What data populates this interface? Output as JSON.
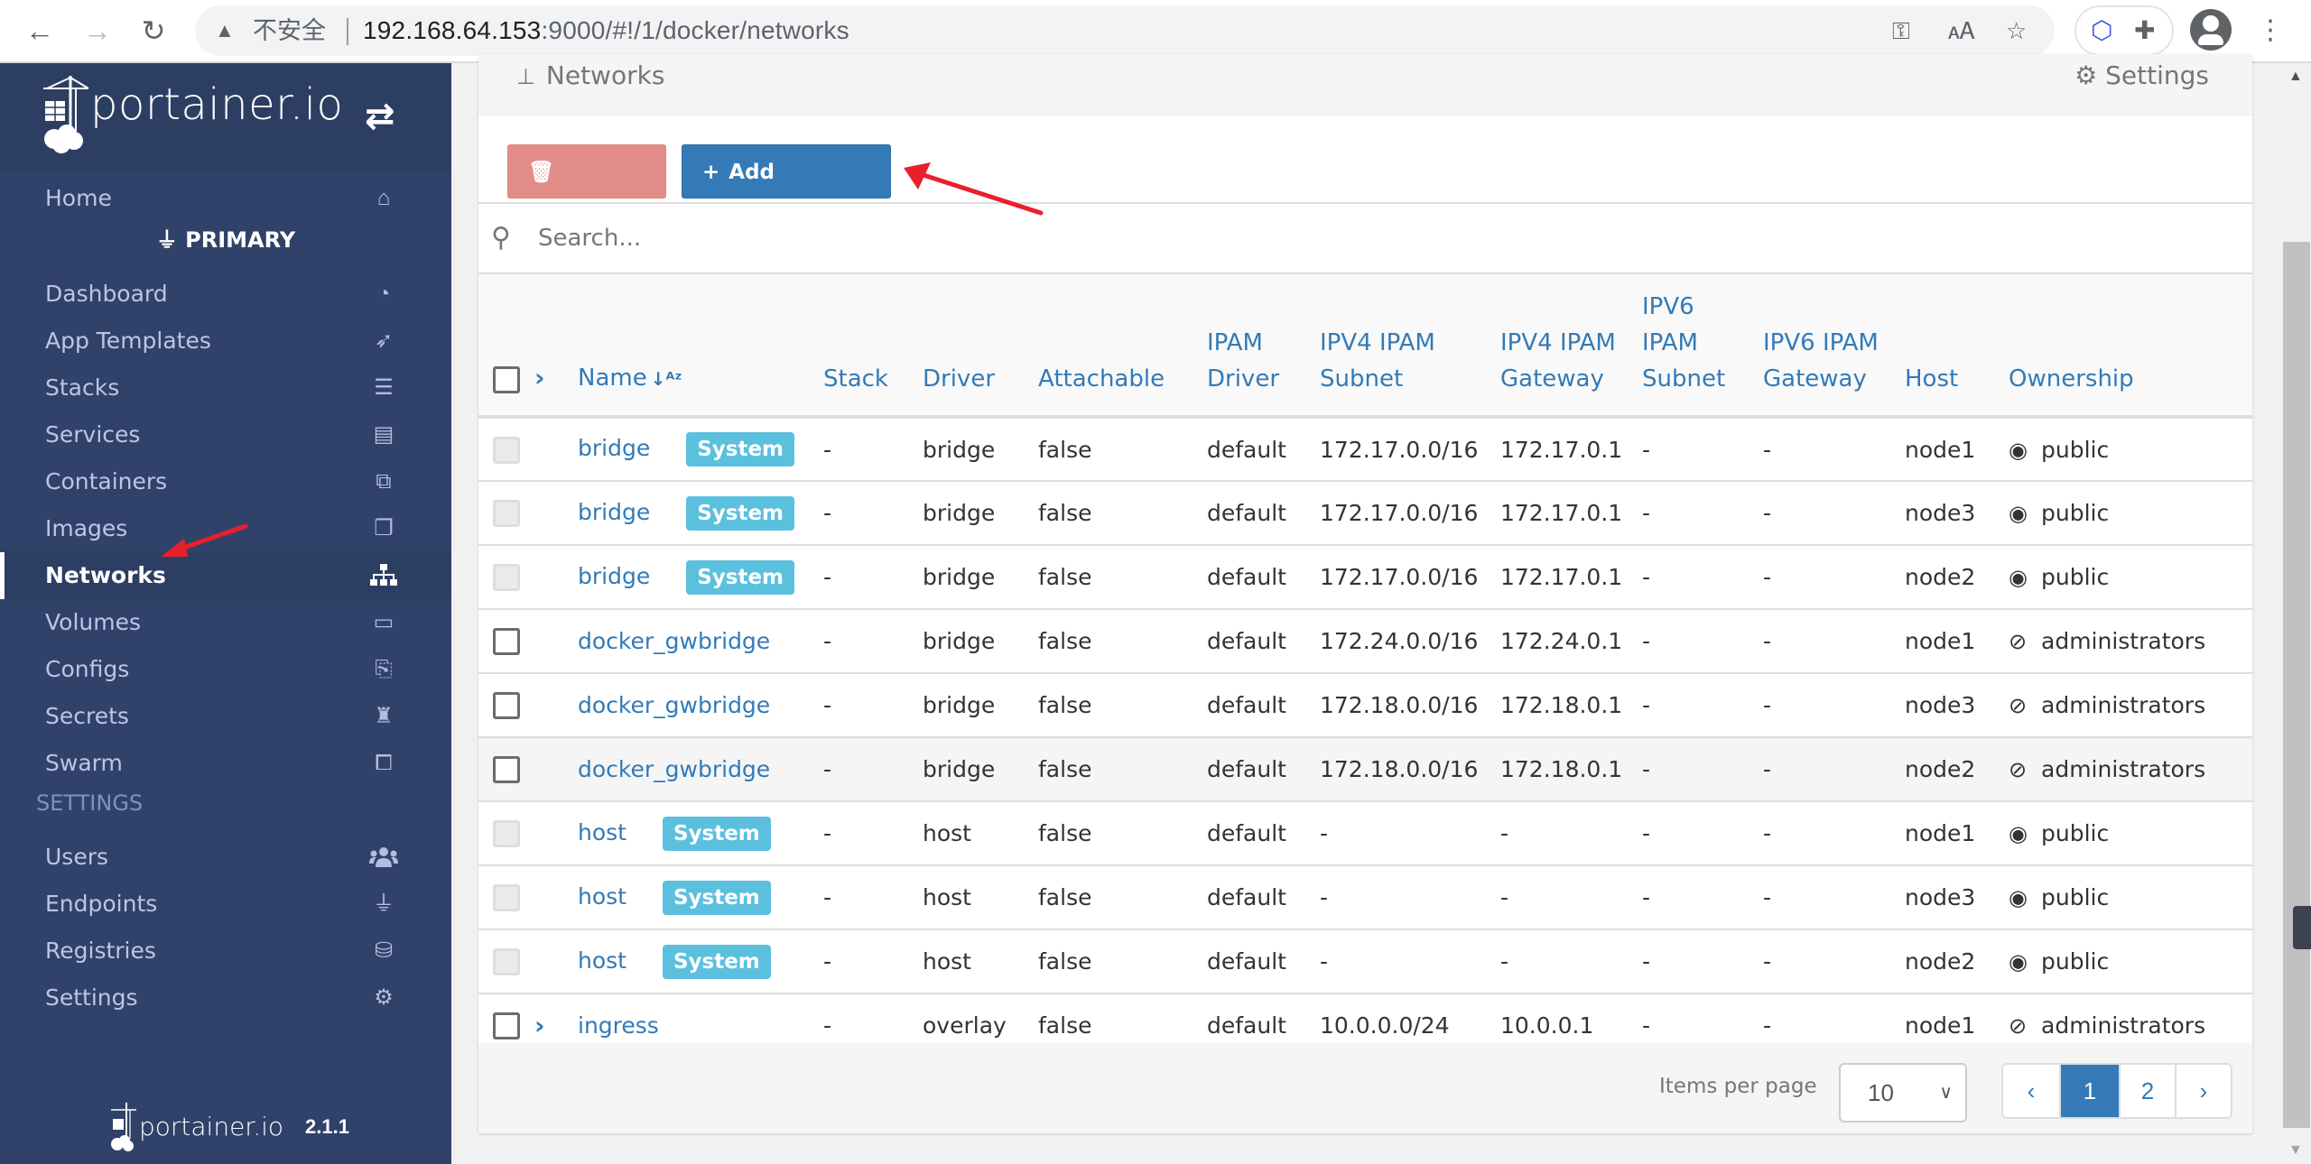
{
  "browser": {
    "security_label": "不安全",
    "url_host": "192.168.64.153",
    "url_rest": ":9000/#!/1/docker/networks",
    "icons": [
      "back-icon",
      "forward-icon",
      "reload-icon",
      "warning-icon",
      "key-icon",
      "translate-icon",
      "star-icon",
      "extension-cube-icon",
      "puzzle-icon",
      "profile-icon",
      "menu-icon"
    ]
  },
  "sidebar": {
    "brand": "portainer.io",
    "endpoint": "PRIMARY",
    "section_settings": "SETTINGS",
    "version": "2.1.1",
    "items": [
      {
        "label": "Home",
        "icon": "home-icon",
        "glyph": "⌂"
      },
      {
        "label": "Dashboard",
        "icon": "tachometer-icon",
        "glyph": "◔"
      },
      {
        "label": "App Templates",
        "icon": "rocket-icon",
        "glyph": "➶"
      },
      {
        "label": "Stacks",
        "icon": "th-list-icon",
        "glyph": "☰"
      },
      {
        "label": "Services",
        "icon": "list-alt-icon",
        "glyph": "▤"
      },
      {
        "label": "Containers",
        "icon": "cubes-icon",
        "glyph": "⧉"
      },
      {
        "label": "Images",
        "icon": "clone-icon",
        "glyph": "❐"
      },
      {
        "label": "Networks",
        "icon": "sitemap-icon",
        "glyph": "⊥",
        "active": true
      },
      {
        "label": "Volumes",
        "icon": "hdd-icon",
        "glyph": "▭"
      },
      {
        "label": "Configs",
        "icon": "file-code-icon",
        "glyph": "⎘"
      },
      {
        "label": "Secrets",
        "icon": "user-secret-icon",
        "glyph": "♜"
      },
      {
        "label": "Swarm",
        "icon": "object-group-icon",
        "glyph": "⧠"
      },
      {
        "label": "Users",
        "icon": "users-icon",
        "glyph": "👥"
      },
      {
        "label": "Endpoints",
        "icon": "plug-icon",
        "glyph": "⏚"
      },
      {
        "label": "Registries",
        "icon": "database-icon",
        "glyph": "⛁"
      },
      {
        "label": "Settings",
        "icon": "cogs-icon",
        "glyph": "⚙"
      }
    ]
  },
  "panel": {
    "title": "Networks",
    "settings_label": "Settings",
    "remove_label": "Remove",
    "add_label": "Add network",
    "search_placeholder": "Search..."
  },
  "table": {
    "headers": [
      "Name",
      "Stack",
      "Driver",
      "Attachable",
      "IPAM Driver",
      "IPV4 IPAM Subnet",
      "IPV4 IPAM Gateway",
      "IPV6 IPAM Subnet",
      "IPV6 IPAM Gateway",
      "Host",
      "Ownership"
    ],
    "rows": [
      {
        "name": "bridge",
        "system": true,
        "stack": "-",
        "driver": "bridge",
        "attachable": "false",
        "ipam_driver": "default",
        "ipv4_subnet": "172.17.0.0/16",
        "ipv4_gateway": "172.17.0.1",
        "ipv6_subnet": "-",
        "ipv6_gateway": "-",
        "host": "node1",
        "ownership": "public"
      },
      {
        "name": "bridge",
        "system": true,
        "stack": "-",
        "driver": "bridge",
        "attachable": "false",
        "ipam_driver": "default",
        "ipv4_subnet": "172.17.0.0/16",
        "ipv4_gateway": "172.17.0.1",
        "ipv6_subnet": "-",
        "ipv6_gateway": "-",
        "host": "node3",
        "ownership": "public"
      },
      {
        "name": "bridge",
        "system": true,
        "stack": "-",
        "driver": "bridge",
        "attachable": "false",
        "ipam_driver": "default",
        "ipv4_subnet": "172.17.0.0/16",
        "ipv4_gateway": "172.17.0.1",
        "ipv6_subnet": "-",
        "ipv6_gateway": "-",
        "host": "node2",
        "ownership": "public"
      },
      {
        "name": "docker_gwbridge",
        "system": false,
        "stack": "-",
        "driver": "bridge",
        "attachable": "false",
        "ipam_driver": "default",
        "ipv4_subnet": "172.24.0.0/16",
        "ipv4_gateway": "172.24.0.1",
        "ipv6_subnet": "-",
        "ipv6_gateway": "-",
        "host": "node1",
        "ownership": "administrators"
      },
      {
        "name": "docker_gwbridge",
        "system": false,
        "stack": "-",
        "driver": "bridge",
        "attachable": "false",
        "ipam_driver": "default",
        "ipv4_subnet": "172.18.0.0/16",
        "ipv4_gateway": "172.18.0.1",
        "ipv6_subnet": "-",
        "ipv6_gateway": "-",
        "host": "node3",
        "ownership": "administrators"
      },
      {
        "name": "docker_gwbridge",
        "system": false,
        "stack": "-",
        "driver": "bridge",
        "attachable": "false",
        "ipam_driver": "default",
        "ipv4_subnet": "172.18.0.0/16",
        "ipv4_gateway": "172.18.0.1",
        "ipv6_subnet": "-",
        "ipv6_gateway": "-",
        "host": "node2",
        "ownership": "administrators",
        "hover": true
      },
      {
        "name": "host",
        "system": true,
        "stack": "-",
        "driver": "host",
        "attachable": "false",
        "ipam_driver": "default",
        "ipv4_subnet": "-",
        "ipv4_gateway": "-",
        "ipv6_subnet": "-",
        "ipv6_gateway": "-",
        "host": "node1",
        "ownership": "public"
      },
      {
        "name": "host",
        "system": true,
        "stack": "-",
        "driver": "host",
        "attachable": "false",
        "ipam_driver": "default",
        "ipv4_subnet": "-",
        "ipv4_gateway": "-",
        "ipv6_subnet": "-",
        "ipv6_gateway": "-",
        "host": "node3",
        "ownership": "public"
      },
      {
        "name": "host",
        "system": true,
        "stack": "-",
        "driver": "host",
        "attachable": "false",
        "ipam_driver": "default",
        "ipv4_subnet": "-",
        "ipv4_gateway": "-",
        "ipv6_subnet": "-",
        "ipv6_gateway": "-",
        "host": "node2",
        "ownership": "public"
      },
      {
        "name": "ingress",
        "system": false,
        "expandable": true,
        "stack": "-",
        "driver": "overlay",
        "attachable": "false",
        "ipam_driver": "default",
        "ipv4_subnet": "10.0.0.0/24",
        "ipv4_gateway": "10.0.0.1",
        "ipv6_subnet": "-",
        "ipv6_gateway": "-",
        "host": "node1",
        "ownership": "administrators"
      }
    ],
    "system_badge": "System"
  },
  "pagination": {
    "items_per_page_label": "Items per page",
    "items_per_page": "10",
    "prev": "‹",
    "pages": [
      "1",
      "2"
    ],
    "current_page": "1",
    "next": "›"
  },
  "colors": {
    "sidebar_bg": "#30426a",
    "primary": "#337ab7",
    "danger_disabled": "#e38d8b",
    "badge_info": "#5bc0de"
  }
}
